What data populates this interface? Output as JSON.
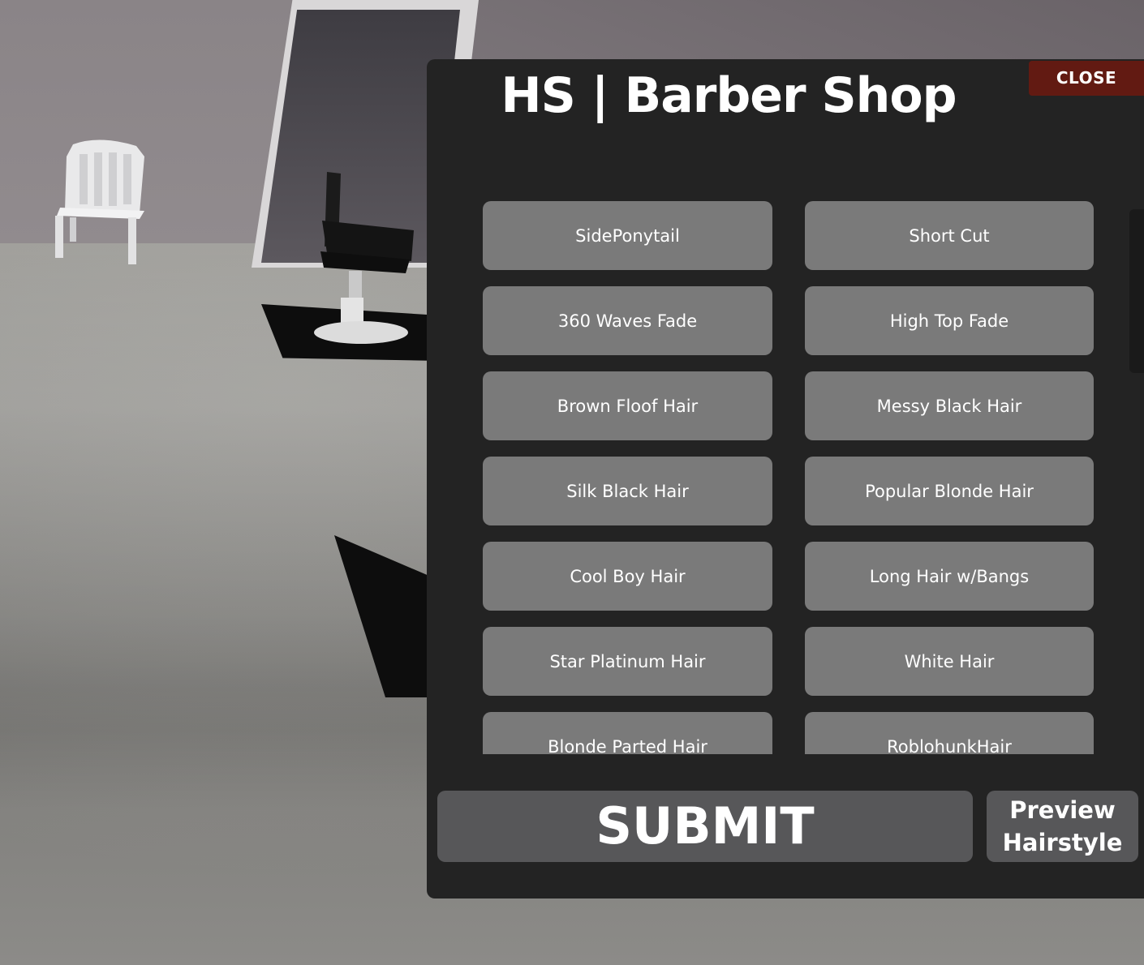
{
  "panel": {
    "title": "HS | Barber Shop",
    "close_label": "CLOSE"
  },
  "hairstyles": [
    {
      "label": "SidePonytail"
    },
    {
      "label": "Short Cut"
    },
    {
      "label": "360 Waves Fade"
    },
    {
      "label": "High Top Fade"
    },
    {
      "label": "Brown Floof Hair"
    },
    {
      "label": "Messy Black Hair"
    },
    {
      "label": "Silk Black Hair"
    },
    {
      "label": "Popular Blonde Hair"
    },
    {
      "label": "Cool Boy Hair"
    },
    {
      "label": "Long Hair w/Bangs"
    },
    {
      "label": "Star Platinum Hair"
    },
    {
      "label": "White Hair"
    },
    {
      "label": "Blonde Parted Hair"
    },
    {
      "label": "RoblohunkHair"
    }
  ],
  "actions": {
    "submit_label": "SUBMIT",
    "preview_label": "Preview\nHairstyle"
  },
  "colors": {
    "panel_bg": "#232323",
    "close_bg": "#621a12",
    "option_bg": "#7a7a7a",
    "action_bg": "#575759"
  }
}
